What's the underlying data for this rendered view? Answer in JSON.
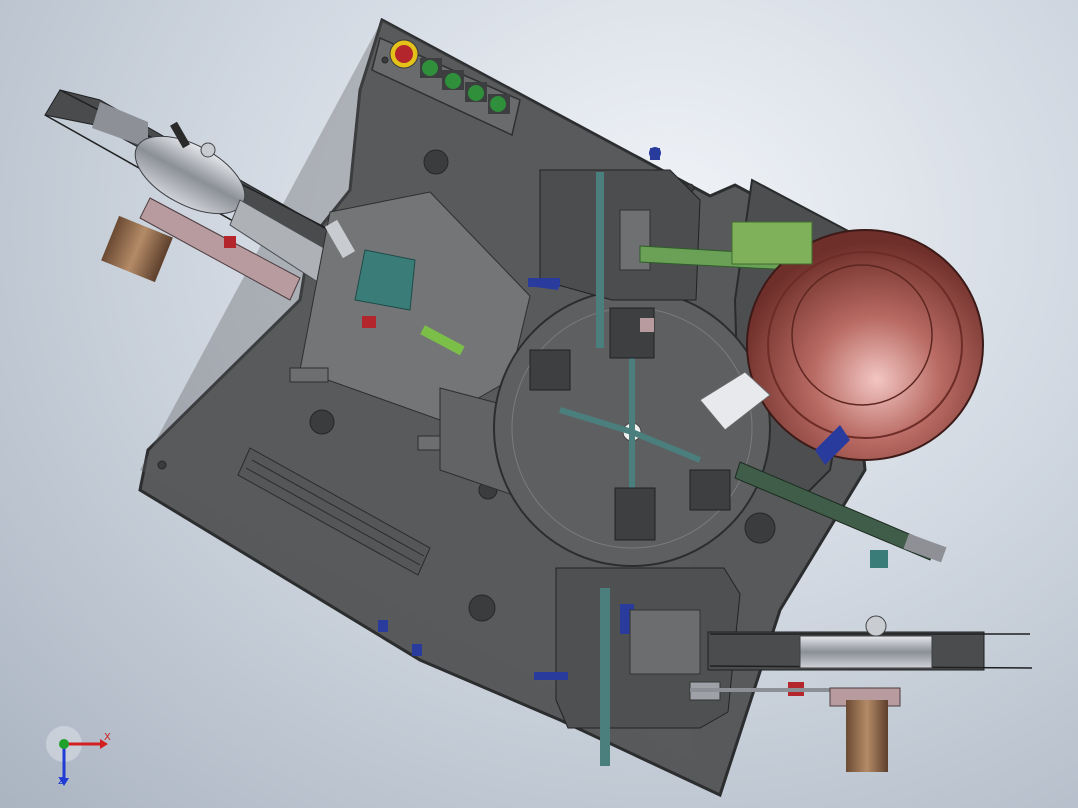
{
  "viewport": {
    "background_top": "#f1f4f8",
    "background_bottom": "#aab4c1"
  },
  "model": {
    "plate_color": "#5a5b5d",
    "plate_edge": "#2e2f31",
    "bowl_color": "#b86a63",
    "bowl_inner": "#8e4740",
    "bracket_color": "#4a7f7d",
    "accent_blue": "#2a3b9e",
    "accent_red": "#b3262b",
    "accent_green": "#2f8f3a",
    "reel_color": "#a3a6ad",
    "motor_color": "#9b7150",
    "track_color": "#6aa157"
  },
  "control_panel": {
    "emergency_stop": "emergency-stop-icon",
    "buttons": [
      "green",
      "green",
      "green",
      "green"
    ]
  },
  "triad": {
    "x_label": "X",
    "z_label": "Z",
    "x_color": "#d21f1f",
    "y_color": "#1fa12c",
    "z_color": "#1f3bd6"
  }
}
